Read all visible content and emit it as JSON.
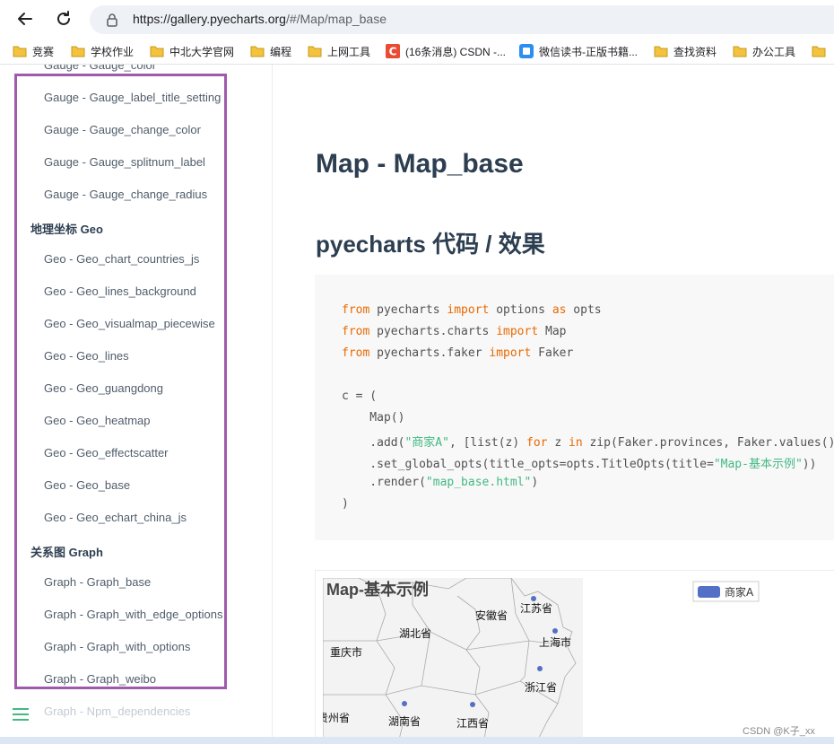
{
  "browser": {
    "url_host": "https://gallery.pyecharts.org",
    "url_path": "/#/Map/map_base",
    "bookmarks": [
      {
        "label": "竞赛",
        "icon": "folder-icon"
      },
      {
        "label": "学校作业",
        "icon": "folder-icon"
      },
      {
        "label": "中北大学官网",
        "icon": "folder-icon"
      },
      {
        "label": "编程",
        "icon": "folder-icon"
      },
      {
        "label": "上网工具",
        "icon": "folder-icon"
      },
      {
        "label": "(16条消息) CSDN -...",
        "icon": "csdn-icon"
      },
      {
        "label": "微信读书-正版书籍...",
        "icon": "weread-icon"
      },
      {
        "label": "查找资料",
        "icon": "folder-icon"
      },
      {
        "label": "办公工具",
        "icon": "folder-icon"
      }
    ]
  },
  "sidebar": {
    "clipped_top": "Gauge - Gauge_color",
    "items": [
      {
        "label": "Gauge - Gauge_label_title_setting",
        "type": "item"
      },
      {
        "label": "Gauge - Gauge_change_color",
        "type": "item"
      },
      {
        "label": "Gauge - Gauge_splitnum_label",
        "type": "item"
      },
      {
        "label": "Gauge - Gauge_change_radius",
        "type": "item"
      },
      {
        "label": "地理坐标 Geo",
        "type": "heading"
      },
      {
        "label": "Geo - Geo_chart_countries_js",
        "type": "item"
      },
      {
        "label": "Geo - Geo_lines_background",
        "type": "item"
      },
      {
        "label": "Geo - Geo_visualmap_piecewise",
        "type": "item"
      },
      {
        "label": "Geo - Geo_lines",
        "type": "item"
      },
      {
        "label": "Geo - Geo_guangdong",
        "type": "item"
      },
      {
        "label": "Geo - Geo_heatmap",
        "type": "item"
      },
      {
        "label": "Geo - Geo_effectscatter",
        "type": "item"
      },
      {
        "label": "Geo - Geo_base",
        "type": "item"
      },
      {
        "label": "Geo - Geo_echart_china_js",
        "type": "item"
      },
      {
        "label": "关系图 Graph",
        "type": "heading"
      },
      {
        "label": "Graph - Graph_base",
        "type": "item"
      },
      {
        "label": "Graph - Graph_with_edge_options",
        "type": "item"
      },
      {
        "label": "Graph - Graph_with_options",
        "type": "item"
      },
      {
        "label": "Graph - Graph_weibo",
        "type": "item"
      }
    ],
    "faded_bottom": "Graph - Npm_dependencies"
  },
  "main": {
    "page_title": "Map - Map_base",
    "section_title": "pyecharts 代码 / 效果",
    "code": {
      "l1_kw1": "from",
      "l1_mod": " pyecharts ",
      "l1_kw2": "import",
      "l1_name": " options ",
      "l1_kw3": "as",
      "l1_alias": " opts",
      "l2_kw1": "from",
      "l2_mod": " pyecharts.charts ",
      "l2_kw2": "import",
      "l2_name": " Map",
      "l3_kw1": "from",
      "l3_mod": " pyecharts.faker ",
      "l3_kw2": "import",
      "l3_name": " Faker",
      "l4": "c = (",
      "l5": "    Map()",
      "l6_a": "    .add(",
      "l6_str": "\"商家A\"",
      "l6_b": ", [list(z) ",
      "l6_kw1": "for",
      "l6_c": " z ",
      "l6_kw2": "in",
      "l6_d": " zip(Faker.provinces, Faker.values())",
      "l7_a": "    .set_global_opts(title_opts=opts.TitleOpts(title=",
      "l7_str": "\"Map-基本示例\"",
      "l7_b": "))",
      "l8_a": "    .render(",
      "l8_str": "\"map_base.html\"",
      "l8_b": ")",
      "l9": ")"
    },
    "chart": {
      "title": "Map-基本示例",
      "legend": "商家A",
      "legend_color": "#5470c6",
      "provinces": [
        "江苏省",
        "安徽省",
        "湖北省",
        "重庆市",
        "上海市",
        "浙江省",
        "湖南省",
        "江西省",
        "贵州省"
      ]
    }
  },
  "watermark": "CSDN @K子_xx",
  "colors": {
    "highlight": "#a05aac",
    "keyword": "#e96900",
    "string": "#42b983",
    "accent": "#42b983"
  }
}
